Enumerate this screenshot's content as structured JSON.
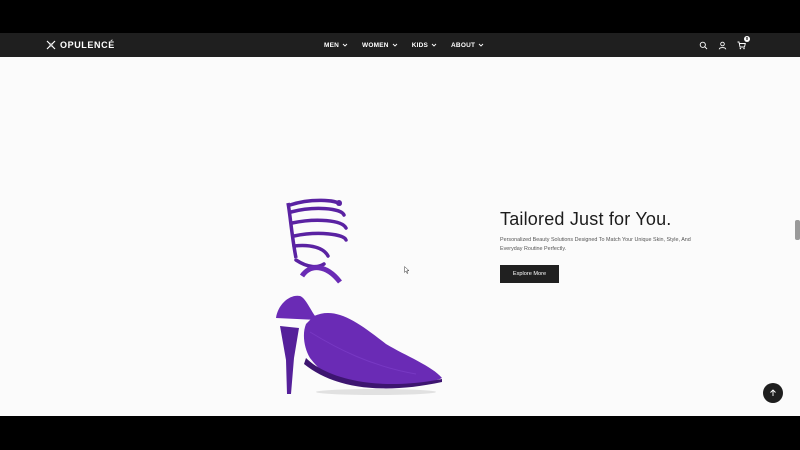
{
  "brand": {
    "name": "OPULENCÉ",
    "logo_icon": "sparkle-cross-icon"
  },
  "nav": {
    "items": [
      {
        "label": "MEN"
      },
      {
        "label": "WOMEN"
      },
      {
        "label": "KIDS"
      },
      {
        "label": "ABOUT"
      }
    ],
    "actions": {
      "search_icon": "search-icon",
      "account_icon": "user-icon",
      "cart_icon": "cart-icon",
      "cart_count": "0"
    }
  },
  "hero": {
    "title": "Tailored Just for You.",
    "subtitle": "Personalized Beauty Solutions Designed To Match Your Unique Skin, Style, And Everyday Routine Perfectly.",
    "cta_label": "Explore More",
    "image": "purple-lace-up-heel"
  },
  "scroll_top": {
    "icon": "arrow-up-icon"
  },
  "colors": {
    "navbar_bg": "#1f1f1f",
    "page_bg": "#fbfbfb",
    "shoe_purple": "#6a2bb5",
    "button_bg": "#202020"
  }
}
